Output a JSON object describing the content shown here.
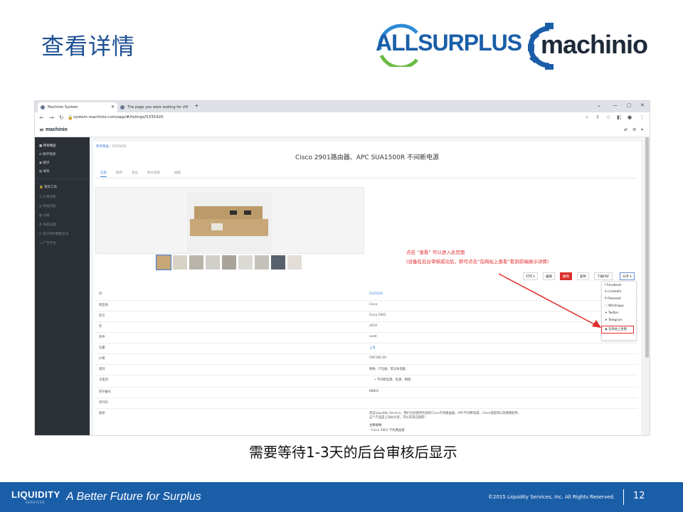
{
  "slide": {
    "title": "查看详情",
    "caption": "需要等待1-3天的后台审核后显示"
  },
  "logos": {
    "allsurplus_part1": "ALL",
    "allsurplus_part2": "SURPLUS",
    "machinio": "machinio"
  },
  "browser": {
    "tab1_title": "Machinio System",
    "tab2_title": "The page you were looking for d",
    "url": "system.machinio.com/app/#/listings/5335420"
  },
  "app": {
    "brand": "machinio",
    "sidebar": {
      "items": [
        {
          "label": "所有物品",
          "icon": "grid-icon",
          "state": "active"
        },
        {
          "label": "数字链接",
          "icon": "exchange-icon",
          "state": "normal"
        },
        {
          "label": "翻译",
          "icon": "translate-icon",
          "state": "normal"
        },
        {
          "label": "联系",
          "icon": "contacts-icon",
          "state": "normal"
        },
        {
          "label": "我的工具",
          "icon": "lock-icon",
          "state": "normal"
        },
        {
          "label": "价格对象",
          "icon": "list-icon",
          "state": "dim"
        },
        {
          "label": "网站内容",
          "icon": "globe-icon",
          "state": "dim"
        },
        {
          "label": "分类",
          "icon": "file-icon",
          "state": "dim"
        },
        {
          "label": "商品设置",
          "icon": "settings-icon",
          "state": "dim"
        },
        {
          "label": "电子邮件模板合法",
          "icon": "mail-icon",
          "state": "dim"
        },
        {
          "label": "广告平台",
          "icon": "monitor-icon",
          "state": "dim"
        }
      ]
    },
    "breadcrumb_link": "所有物品",
    "breadcrumb_sep": " / ",
    "breadcrumb_current": "5335420",
    "page_title": "Cisco 2901路由器、APC SUA1500R 不间断电源",
    "subtabs": [
      "信息",
      "翻译",
      "发生",
      "图片链接",
      "编辑"
    ],
    "annotation_line1": "点击 “查看” 可以进入此页面",
    "annotation_line2": "(设备在后台审核成功后，即可点击“在网站上查看”看到前端展示详情)",
    "actions": {
      "print": "打印 ▾",
      "edit": "编辑",
      "delete": "删除",
      "copy": "复制",
      "pdf": "下载PDF",
      "share": "分享 ▾"
    },
    "share_menu": {
      "facebook": "Facebook",
      "linkedin": "LinkedIn",
      "pinterest": "Pinterest",
      "whatsapp": "Whatsapp",
      "twitter": "Twitter",
      "telegram": "Telegram",
      "view_on_site": "在网站上查看"
    },
    "details": [
      {
        "key": "ID",
        "value": "5335420",
        "link": true
      },
      {
        "key": "制造商",
        "value": "Cisco",
        "link": false
      },
      {
        "key": "型号",
        "value": "Cisco 2901",
        "link": false
      },
      {
        "key": "年",
        "value": "2010",
        "link": false
      },
      {
        "key": "条件",
        "value": "used",
        "link": false
      },
      {
        "key": "位置",
        "value": "上海",
        "link": true
      },
      {
        "key": "价格",
        "value": "CNY100.00",
        "link": false
      },
      {
        "key": "类别",
        "value": "网络、IT设备、笔记本电脑",
        "link": false
      },
      {
        "key": "子类别",
        "value": "•  不间断电源、电源、网络",
        "link": false
      },
      {
        "key": "库存编号",
        "value": "88801",
        "link": false
      },
      {
        "key": "序列号",
        "value": "",
        "link": false
      },
      {
        "key": "描述",
        "value": "来自Liquidity Service，我们为您提供优质的Cisco千兆路由器，APC不间断电源，Cisco电缆和以及网络配件。",
        "link": false
      }
    ],
    "desc_more_1": "这个产品是上海办公室，可以前来自提取!",
    "desc_more_2": "主要规格:",
    "desc_more_3": "- Cisco 2901 千兆路由器"
  },
  "footer": {
    "logo": "LIQUIDITY",
    "logo_sub": "SERVICES",
    "tagline": "A Better Future for Surplus",
    "copyright": "©2015 Liquidity Services, Inc.  All Rights Reserved.",
    "page": "12"
  },
  "colors": {
    "accent": "#1b5ea8",
    "annotation": "#e02b2b",
    "sidebar": "#2b2f36"
  }
}
